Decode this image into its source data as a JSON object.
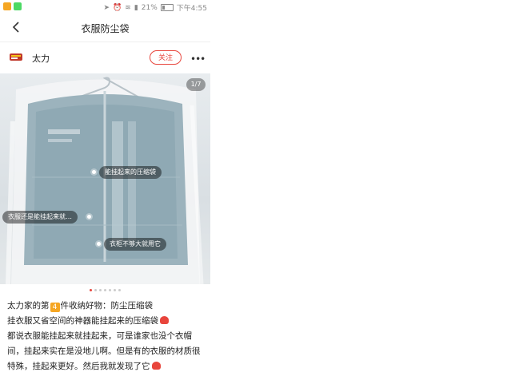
{
  "status_bar": {
    "battery": "21%",
    "time": "下午4:55",
    "app_icon_colors": [
      "#f5a623",
      "#4cd964"
    ]
  },
  "navbar": {
    "title": "衣服防尘袋"
  },
  "author": {
    "name": "太力",
    "follow_label": "关注",
    "more_label": "•••"
  },
  "photo": {
    "counter": "1/7",
    "tags": [
      {
        "label": "能挂起来的压缩袋"
      },
      {
        "label": "衣服还是能挂起来就…"
      },
      {
        "label": "衣柜不够大就用它"
      }
    ],
    "slides_total": 7,
    "active_slide": 1
  },
  "post": {
    "line1_prefix": "太力家的第",
    "line1_num": "4",
    "line1_suffix": "件收纳好物：防尘压缩袋",
    "line2": "挂衣服又省空间的神器能挂起来的压缩袋",
    "line3": "都说衣服能挂起来就挂起来，可是谁家也没个衣帽间，挂起来实在是没地儿啊。但是有的衣服的材质很特殊，挂起来更好。然后我就发现了它"
  },
  "colors": {
    "accent": "#e8453c"
  }
}
